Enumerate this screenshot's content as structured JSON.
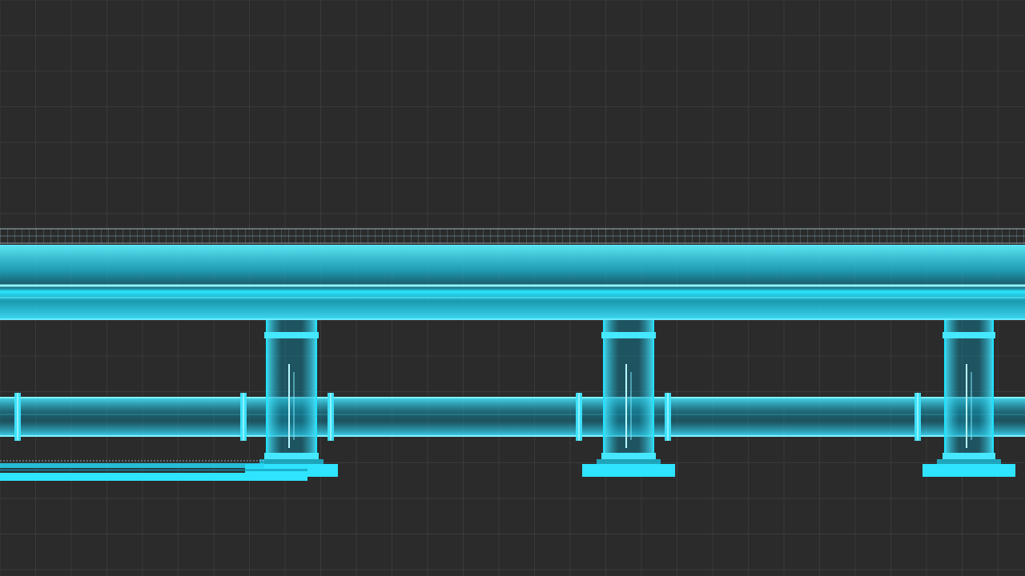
{
  "scene": {
    "description_free": true,
    "colors": {
      "background": "#2b2b2b",
      "grid": "#3a3a3a",
      "accent": "#1ee3ff",
      "accent_dim": "#0fa6c4"
    }
  }
}
